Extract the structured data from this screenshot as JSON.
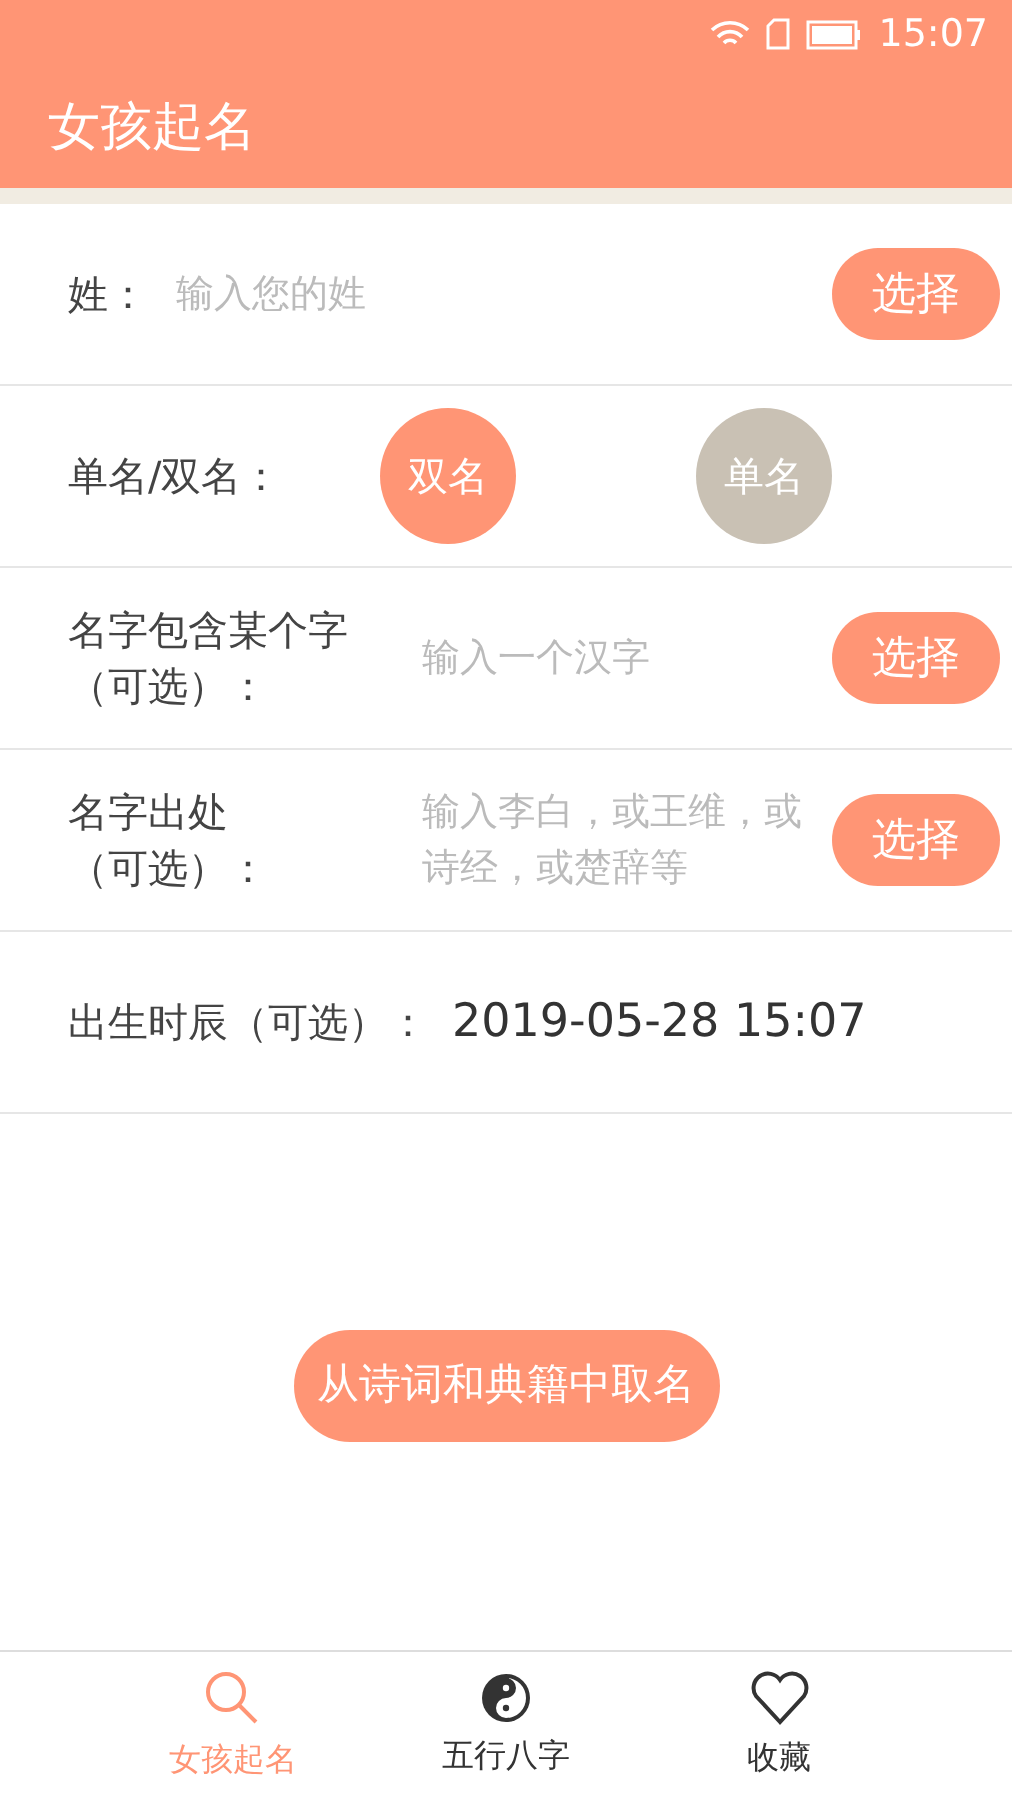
{
  "status_bar": {
    "time": "15:07"
  },
  "header": {
    "title": "女孩起名"
  },
  "form": {
    "rows": [
      {
        "kind": "input",
        "label": "姓：",
        "placeholder": "输入您的姓",
        "button": "选择"
      },
      {
        "kind": "choice",
        "label": "单名/双名：",
        "options": [
          {
            "label": "双名",
            "selected": true
          },
          {
            "label": "单名",
            "selected": false
          }
        ]
      },
      {
        "kind": "input",
        "label": "名字包含某个字（可选）：",
        "placeholder": "输入一个汉字",
        "button": "选择"
      },
      {
        "kind": "input",
        "label": "名字出处（可选）：",
        "placeholder": "输入李白，或王维，或诗经，或楚辞等",
        "button": "选择"
      },
      {
        "kind": "value",
        "label": "出生时辰（可选）：",
        "value": "2019-05-28 15:07"
      }
    ]
  },
  "submit": "从诗词和典籍中取名",
  "tabs": [
    {
      "label": "女孩起名",
      "selected": true
    },
    {
      "label": "五行八字",
      "selected": false
    },
    {
      "label": "收藏",
      "selected": false
    }
  ]
}
